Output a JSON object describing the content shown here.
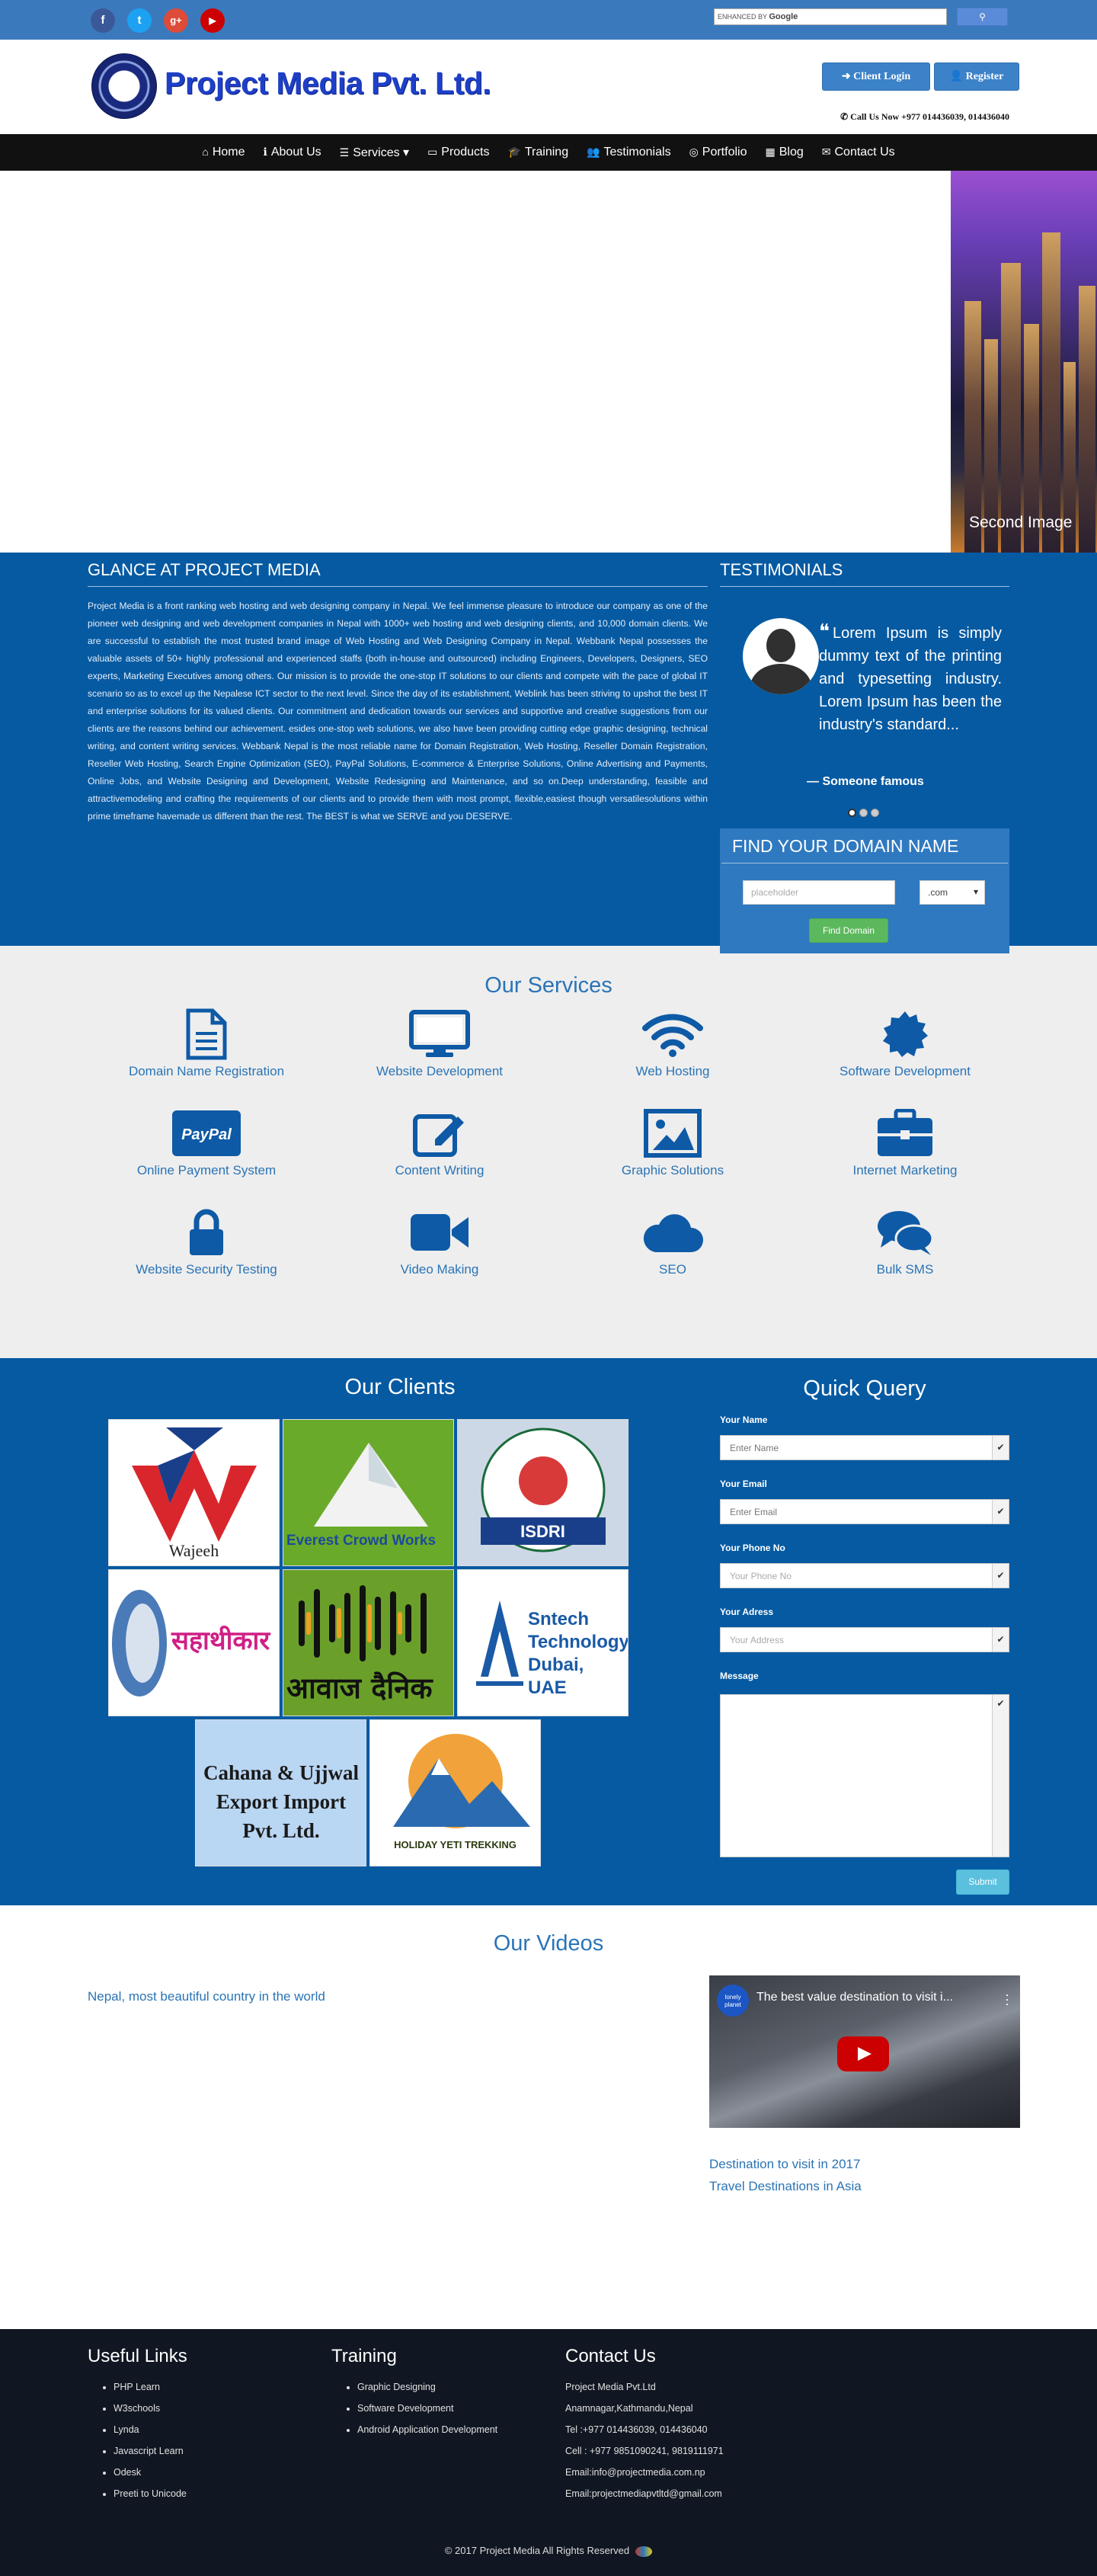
{
  "topbar": {
    "social": [
      {
        "icon": "facebook-icon",
        "glyph": "f",
        "color": "#3b5998"
      },
      {
        "icon": "twitter-icon",
        "glyph": "t",
        "color": "#1da1f2"
      },
      {
        "icon": "google-plus-icon",
        "glyph": "g+",
        "color": "#dd4b39"
      },
      {
        "icon": "youtube-icon",
        "glyph": "▶",
        "color": "#cc0000"
      }
    ],
    "search_enhanced": "ENHANCED BY",
    "search_brand": "Google"
  },
  "header": {
    "logo_text": "Project Media Pvt. Ltd.",
    "client_login": "Client Login",
    "register": "Register",
    "call_now": "Call Us Now +977 014436039, 014436040"
  },
  "nav": {
    "items": [
      {
        "label": "Home",
        "icon": "home-icon",
        "glyph": "⌂"
      },
      {
        "label": "About Us",
        "icon": "info-icon",
        "glyph": "ℹ"
      },
      {
        "label": "Services ▾",
        "icon": "list-icon",
        "glyph": "☰"
      },
      {
        "label": "Products",
        "icon": "folder-icon",
        "glyph": "▭"
      },
      {
        "label": "Training",
        "icon": "graduation-cap-icon",
        "glyph": "🎓"
      },
      {
        "label": "Testimonials",
        "icon": "users-icon",
        "glyph": "👥"
      },
      {
        "label": "Portfolio",
        "icon": "compass-icon",
        "glyph": "◎"
      },
      {
        "label": "Blog",
        "icon": "grid-icon",
        "glyph": "▦"
      },
      {
        "label": "Contact Us",
        "icon": "envelope-icon",
        "glyph": "✉"
      }
    ]
  },
  "slider": {
    "caption": "Second Image"
  },
  "glance": {
    "title": "GLANCE AT PROJECT MEDIA",
    "body": "Project Media is a front ranking web hosting and web designing company in Nepal. We feel immense pleasure to introduce our company as one of the pioneer web designing and web development companies in Nepal with 1000+ web hosting and web designing clients, and 10,000 domain clients. We are successful to establish the most trusted brand image of Web Hosting and Web Designing Company in Nepal. Webbank Nepal possesses the valuable assets of 50+ highly professional and experienced staffs (both in-house and outsourced) including Engineers, Developers, Designers, SEO experts, Marketing Executives among others. Our mission is to provide the one-stop IT solutions to our clients and compete with the pace of global IT scenario so as to excel up the Nepalese ICT sector to the next level. Since the day of its establishment, Weblink has been striving to upshot the best IT and enterprise solutions for its valued clients. Our commitment and dedication towards our services and supportive and creative suggestions from our clients are the reasons behind our achievement. esides one-stop web solutions, we also have been providing cutting edge graphic designing, technical writing, and content writing services. Webbank Nepal is the most reliable name for Domain Registration, Web Hosting, Reseller Domain Registration, Reseller Web Hosting, Search Engine Optimization (SEO), PayPal Solutions, E-commerce & Enterprise Solutions, Online Advertising and Payments, Online Jobs, and Website Designing and Development, Website Redesigning and Maintenance, and so on.Deep understanding, feasible and attractivemodeling and crafting the requirements of our clients and to provide them with most prompt, flexible,easiest though versatilesolutions within prime timeframe havemade us different than the rest. The BEST is what we SERVE and you DESERVE."
  },
  "testimonials": {
    "title": "TESTIMONIALS",
    "quote": "Lorem Ipsum is simply dummy text of the printing and typesetting industry. Lorem Ipsum has been the industry's standard...",
    "author": "— Someone famous"
  },
  "domain": {
    "title": "FIND YOUR DOMAIN NAME",
    "placeholder": "placeholder",
    "tld": ".com",
    "button": "Find Domain"
  },
  "services": {
    "title": "Our Services",
    "items": [
      {
        "label": "Domain Name Registration",
        "icon": "document-icon"
      },
      {
        "label": "Website Development",
        "icon": "monitor-icon"
      },
      {
        "label": "Web Hosting",
        "icon": "wifi-icon"
      },
      {
        "label": "Software Development",
        "icon": "gear-badge-icon"
      },
      {
        "label": "Online Payment System",
        "icon": "paypal-icon"
      },
      {
        "label": "Content Writing",
        "icon": "edit-icon"
      },
      {
        "label": "Graphic Solutions",
        "icon": "image-icon"
      },
      {
        "label": "Internet Marketing",
        "icon": "briefcase-icon"
      },
      {
        "label": "Website Security Testing",
        "icon": "lock-icon"
      },
      {
        "label": "Video Making",
        "icon": "video-camera-icon"
      },
      {
        "label": "SEO",
        "icon": "cloud-icon"
      },
      {
        "label": "Bulk SMS",
        "icon": "chat-icon"
      }
    ],
    "accent": "#0e5aa6"
  },
  "clients": {
    "title": "Our Clients",
    "logos": [
      {
        "name": "Wajeeh",
        "text": "Wajeeh"
      },
      {
        "name": "Everest Crowd Works",
        "text": "Everest Crowd Works"
      },
      {
        "name": "ISDRI",
        "text": "ISDRI"
      },
      {
        "name": "Saathi",
        "text": "सहाथीकार"
      },
      {
        "name": "Awaaj Dainik",
        "text": "आवाज दैनिक"
      },
      {
        "name": "Sntech Technology Dubai UAE",
        "text": "Sntech Technology Dubai, UAE"
      },
      {
        "name": "Cahana & Ujjwal Export Import Pvt. Ltd.",
        "text": "Cahana & Ujjwal Export Import Pvt. Ltd."
      },
      {
        "name": "Holiday Yeti Trekking",
        "text": "HOLIDAY YETI TREKKING"
      }
    ]
  },
  "query": {
    "title": "Quick Query",
    "name_label": "Your Name",
    "name_placeholder": "Enter Name",
    "email_label": "Your Email",
    "email_placeholder": "Enter Email",
    "phone_label": "Your Phone No",
    "phone_placeholder": "Your Phone No",
    "address_label": "Your Adress",
    "address_placeholder": "Your Address",
    "message_label": "Message",
    "submit": "Submit"
  },
  "videos": {
    "title": "Our Videos",
    "left_link": "Nepal, most beautiful country in the world",
    "yt_title": "The best value destination to visit i...",
    "channel": "lonely planet",
    "links": [
      "Destination to visit in 2017",
      "Travel Destinations in Asia"
    ]
  },
  "footer": {
    "useful_title": "Useful Links",
    "useful": [
      "PHP Learn",
      "W3schools",
      "Lynda",
      "Javascript Learn",
      "Odesk",
      "Preeti to Unicode"
    ],
    "training_title": "Training",
    "training": [
      "Graphic Designing",
      "Software Development",
      "Android Application Development"
    ],
    "contact_title": "Contact Us",
    "contact": [
      "Project Media Pvt.Ltd",
      "Anamnagar,Kathmandu,Nepal",
      "Tel :+977 014436039, 014436040",
      "Cell : +977 9851090241, 9819111971",
      "Email:info@projectmedia.com.np",
      "Email:projectmediapvtltd@gmail.com"
    ],
    "copyright": "© 2017 Project Media All Rights Reserved"
  }
}
